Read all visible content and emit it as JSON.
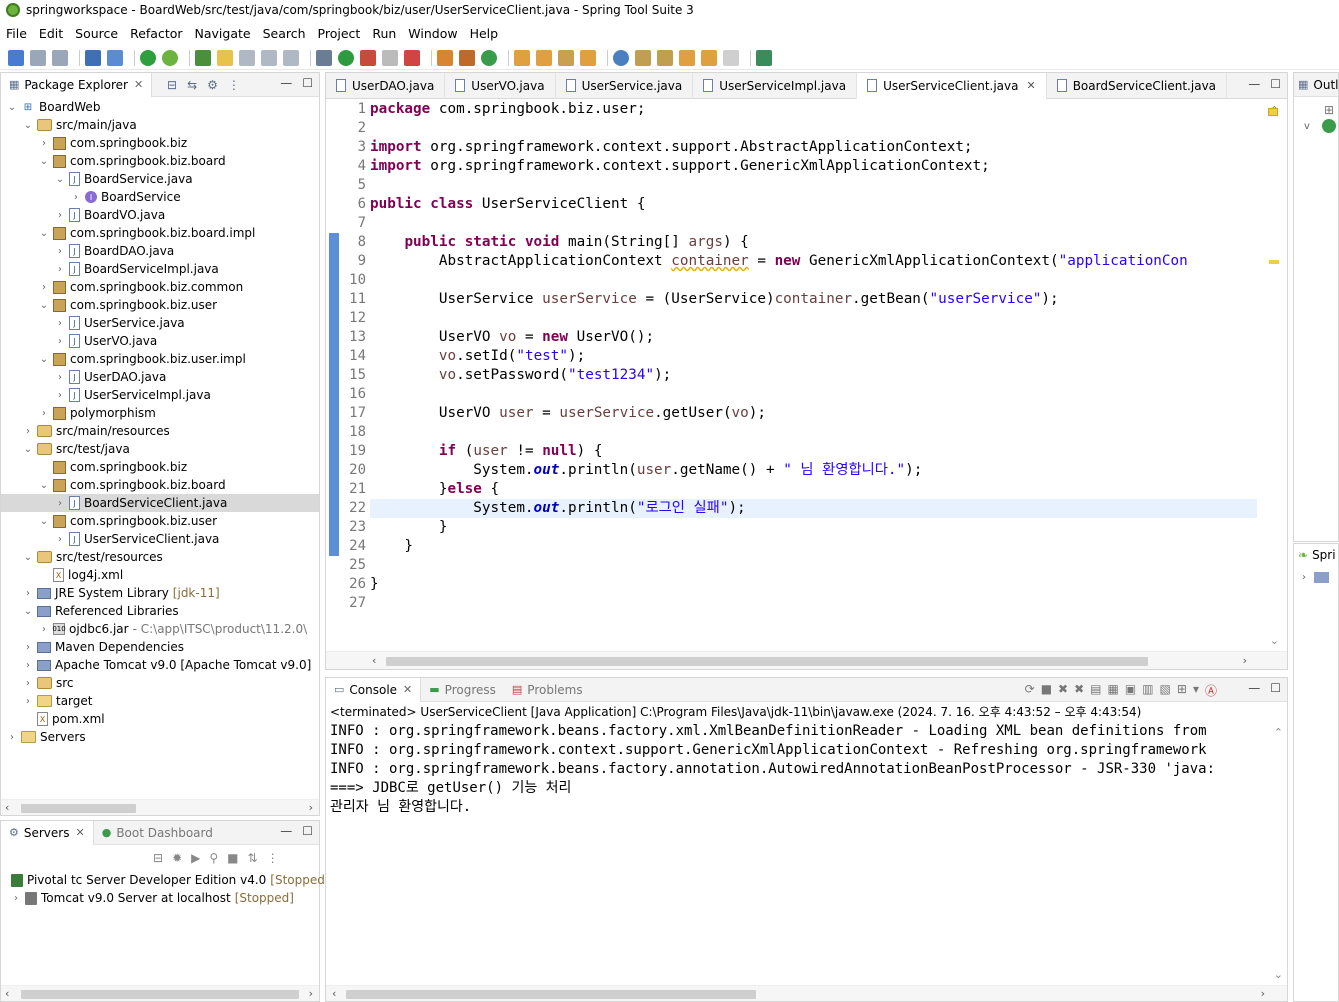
{
  "window": {
    "title": "springworkspace - BoardWeb/src/test/java/com/springbook/biz/user/UserServiceClient.java - Spring Tool Suite 3"
  },
  "menu": [
    "File",
    "Edit",
    "Source",
    "Refactor",
    "Navigate",
    "Search",
    "Project",
    "Run",
    "Window",
    "Help"
  ],
  "package_explorer": {
    "tab_label": "Package Explorer",
    "tree": [
      {
        "label": "BoardWeb",
        "depth": 0,
        "twisty": "v",
        "icon": "proj"
      },
      {
        "label": "src/main/java",
        "depth": 1,
        "twisty": "v",
        "icon": "srcf"
      },
      {
        "label": "com.springbook.biz",
        "depth": 2,
        "twisty": ">",
        "icon": "pkg"
      },
      {
        "label": "com.springbook.biz.board",
        "depth": 2,
        "twisty": "v",
        "icon": "pkg"
      },
      {
        "label": "BoardService.java",
        "depth": 3,
        "twisty": "v",
        "icon": "java"
      },
      {
        "label": "BoardService",
        "depth": 4,
        "twisty": ">",
        "icon": "iface"
      },
      {
        "label": "BoardVO.java",
        "depth": 3,
        "twisty": ">",
        "icon": "java"
      },
      {
        "label": "com.springbook.biz.board.impl",
        "depth": 2,
        "twisty": "v",
        "icon": "pkg"
      },
      {
        "label": "BoardDAO.java",
        "depth": 3,
        "twisty": ">",
        "icon": "java"
      },
      {
        "label": "BoardServiceImpl.java",
        "depth": 3,
        "twisty": ">",
        "icon": "java"
      },
      {
        "label": "com.springbook.biz.common",
        "depth": 2,
        "twisty": ">",
        "icon": "pkg"
      },
      {
        "label": "com.springbook.biz.user",
        "depth": 2,
        "twisty": "v",
        "icon": "pkg"
      },
      {
        "label": "UserService.java",
        "depth": 3,
        "twisty": ">",
        "icon": "java"
      },
      {
        "label": "UserVO.java",
        "depth": 3,
        "twisty": ">",
        "icon": "java"
      },
      {
        "label": "com.springbook.biz.user.impl",
        "depth": 2,
        "twisty": "v",
        "icon": "pkg"
      },
      {
        "label": "UserDAO.java",
        "depth": 3,
        "twisty": ">",
        "icon": "java"
      },
      {
        "label": "UserServiceImpl.java",
        "depth": 3,
        "twisty": ">",
        "icon": "java"
      },
      {
        "label": "polymorphism",
        "depth": 2,
        "twisty": ">",
        "icon": "pkg"
      },
      {
        "label": "src/main/resources",
        "depth": 1,
        "twisty": ">",
        "icon": "srcf"
      },
      {
        "label": "src/test/java",
        "depth": 1,
        "twisty": "v",
        "icon": "srcf"
      },
      {
        "label": "com.springbook.biz",
        "depth": 2,
        "twisty": "",
        "icon": "pkg"
      },
      {
        "label": "com.springbook.biz.board",
        "depth": 2,
        "twisty": "v",
        "icon": "pkg"
      },
      {
        "label": "BoardServiceClient.java",
        "depth": 3,
        "twisty": ">",
        "icon": "java",
        "selected": true
      },
      {
        "label": "com.springbook.biz.user",
        "depth": 2,
        "twisty": "v",
        "icon": "pkg"
      },
      {
        "label": "UserServiceClient.java",
        "depth": 3,
        "twisty": ">",
        "icon": "java"
      },
      {
        "label": "src/test/resources",
        "depth": 1,
        "twisty": "v",
        "icon": "srcf"
      },
      {
        "label": "log4j.xml",
        "depth": 2,
        "twisty": "",
        "icon": "xml"
      },
      {
        "label": "JRE System Library",
        "suffix": "[jdk-11]",
        "depth": 1,
        "twisty": ">",
        "icon": "lib"
      },
      {
        "label": "Referenced Libraries",
        "depth": 1,
        "twisty": "v",
        "icon": "lib"
      },
      {
        "label": "ojdbc6.jar",
        "suffix": "- C:\\app\\ITSC\\product\\11.2.0\\",
        "depth": 2,
        "twisty": ">",
        "icon": "jar",
        "suffix_grey": true
      },
      {
        "label": "Maven Dependencies",
        "depth": 1,
        "twisty": ">",
        "icon": "lib"
      },
      {
        "label": "Apache Tomcat v9.0 [Apache Tomcat v9.0]",
        "depth": 1,
        "twisty": ">",
        "icon": "lib"
      },
      {
        "label": "src",
        "depth": 1,
        "twisty": ">",
        "icon": "srcf"
      },
      {
        "label": "target",
        "depth": 1,
        "twisty": ">",
        "icon": "folder"
      },
      {
        "label": "pom.xml",
        "depth": 1,
        "twisty": "",
        "icon": "xml"
      },
      {
        "label": "Servers",
        "depth": 0,
        "twisty": ">",
        "icon": "folder"
      }
    ]
  },
  "servers": {
    "tab_label": "Servers",
    "tab2_label": "Boot Dashboard",
    "items": [
      {
        "label": "Pivotal tc Server Developer Edition v4.0",
        "status": "[Stopped]"
      },
      {
        "label": "Tomcat v9.0 Server at localhost",
        "status": "[Stopped]"
      }
    ]
  },
  "editor": {
    "tabs": [
      {
        "label": "UserDAO.java"
      },
      {
        "label": "UserVO.java"
      },
      {
        "label": "UserService.java"
      },
      {
        "label": "UserServiceImpl.java"
      },
      {
        "label": "UserServiceClient.java",
        "active": true
      },
      {
        "label": "BoardServiceClient.java"
      }
    ],
    "lines": [
      "<span class='kw'>package</span> com.springbook.biz.user;",
      "",
      "<span class='kw'>import</span> org.springframework.context.support.AbstractApplicationContext;",
      "<span class='kw'>import</span> org.springframework.context.support.GenericXmlApplicationContext;",
      "",
      "<span class='kw'>public class</span> UserServiceClient {",
      "",
      "    <span class='kw'>public static void</span> main(String[] <span class='var'>args</span>) {",
      "        AbstractApplicationContext <span class='var warn'>container</span> = <span class='kw'>new</span> GenericXmlApplicationContext(<span class='str'>\"applicationCon</span>",
      "",
      "        UserService <span class='var'>userService</span> = (UserService)<span class='var'>container</span>.getBean(<span class='str'>\"userService\"</span>);",
      "",
      "        UserVO <span class='var'>vo</span> = <span class='kw'>new</span> UserVO();",
      "        <span class='var'>vo</span>.setId(<span class='str'>\"test\"</span>);",
      "        <span class='var'>vo</span>.setPassword(<span class='str'>\"test1234\"</span>);",
      "",
      "        UserVO <span class='var'>user</span> = <span class='var'>userService</span>.getUser(<span class='var'>vo</span>);",
      "",
      "        <span class='kw'>if</span> (<span class='var'>user</span> != <span class='kw'>null</span>) {",
      "            System.<span class='fld'>out</span>.println(<span class='var'>user</span>.getName() + <span class='str'>\" 님 환영합니다.\"</span>);",
      "        }<span class='kw'>else</span> {",
      "            System.<span class='fld'>out</span>.println(<span class='str'>\"로그인 실패\"</span>);",
      "        }",
      "    }",
      "",
      "}",
      ""
    ],
    "line_numbers": [
      "1",
      "2",
      "3",
      "4",
      "5",
      "6",
      "7",
      "8",
      "9",
      "10",
      "11",
      "12",
      "13",
      "14",
      "15",
      "16",
      "17",
      "18",
      "19",
      "20",
      "21",
      "22",
      "23",
      "24",
      "25",
      "26",
      "27"
    ],
    "current_line": 22
  },
  "console": {
    "tab_label": "Console",
    "tab2_label": "Progress",
    "tab3_label": "Problems",
    "terminated": "<terminated> UserServiceClient [Java Application] C:\\Program Files\\Java\\jdk-11\\bin\\javaw.exe  (2024. 7. 16. 오후 4:43:52 – 오후 4:43:54)",
    "lines": [
      "INFO : org.springframework.beans.factory.xml.XmlBeanDefinitionReader - Loading XML bean definitions from",
      "INFO : org.springframework.context.support.GenericXmlApplicationContext - Refreshing org.springframework",
      "INFO : org.springframework.beans.factory.annotation.AutowiredAnnotationBeanPostProcessor - JSR-330 'java:",
      "===> JDBC로 getUser() 기능 처리",
      "관리자 님 환영합니다."
    ]
  },
  "outline": {
    "tab_label": "Outl"
  },
  "spring": {
    "tab_label": "Spri"
  },
  "colors": {
    "keyword": "#7f0055",
    "string": "#2a00ff",
    "field": "#0000c0",
    "current_line": "#e8f2fe",
    "ruler_mark": "#5b8fd6"
  }
}
